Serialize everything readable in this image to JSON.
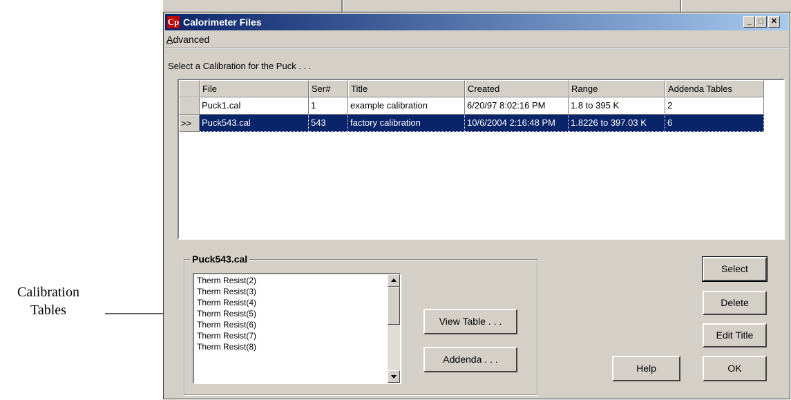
{
  "annotation": {
    "label_line1": "Calibration",
    "label_line2": "Tables"
  },
  "window": {
    "title": "Calorimeter Files",
    "app_icon_text": "Cp"
  },
  "menu": {
    "advanced_label": "dvanced",
    "advanced_accel": "A"
  },
  "prompt": "Select a Calibration for the Puck . . .",
  "table": {
    "columns": [
      "File",
      "Ser#",
      "Title",
      "Created",
      "Range",
      "Addenda Tables"
    ],
    "rows": [
      {
        "indicator": "",
        "cells": [
          "Puck1.cal",
          "1",
          "example calibration",
          "6/20/97 8:02:16 PM",
          "1.8 to 395 K",
          "2"
        ],
        "selected": false
      },
      {
        "indicator": ">>",
        "cells": [
          "Puck543.cal",
          "543",
          "factory calibration",
          "10/6/2004 2:16:48 PM",
          "1.8226 to 397.03 K",
          "6"
        ],
        "selected": true
      }
    ]
  },
  "details": {
    "group_title": "Puck543.cal",
    "tables": [
      "Therm Resist(2)",
      "Therm Resist(3)",
      "Therm Resist(4)",
      "Therm Resist(5)",
      "Therm Resist(6)",
      "Therm Resist(7)",
      "Therm Resist(8)"
    ]
  },
  "buttons": {
    "view_table": "View Table . . .",
    "addenda": "Addenda . . .",
    "select": "Select",
    "delete": "Delete",
    "edit_title": "Edit Title",
    "help": "Help",
    "ok": "OK"
  }
}
